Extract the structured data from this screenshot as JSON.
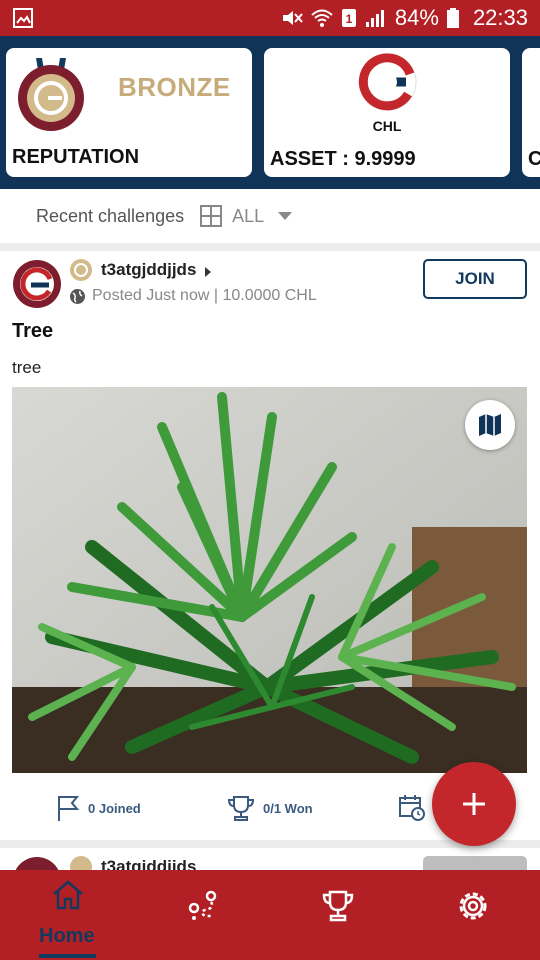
{
  "status_bar": {
    "battery": "84%",
    "time": "22:33",
    "colors": {
      "background": "#b21f24"
    }
  },
  "header": {
    "reputation_card": {
      "level": "BRONZE",
      "title": "REPUTATION"
    },
    "asset_card": {
      "currency": "CHL",
      "asset": "ASSET : 9.9999"
    },
    "partial_card": {
      "letter": "C"
    }
  },
  "filter": {
    "label": "Recent challenges",
    "selected": "ALL"
  },
  "post": {
    "username": "t3atgjddjjds",
    "meta": "Posted Just now | 10.0000 CHL",
    "join_label": "JOIN",
    "title": "Tree",
    "description": "tree",
    "joined": "0 Joined",
    "won": "0/1 Won"
  },
  "post2": {
    "username": "t3atgjddjjds"
  },
  "bottom_nav": {
    "items": [
      {
        "label": "Home",
        "icon": "home-icon"
      },
      {
        "icon": "route-icon"
      },
      {
        "icon": "trophy-icon"
      },
      {
        "icon": "gear-icon"
      }
    ],
    "active": "Home"
  },
  "colors": {
    "brand_red": "#b21f24",
    "navy": "#0f3458",
    "bronze": "#c7ab7a"
  }
}
